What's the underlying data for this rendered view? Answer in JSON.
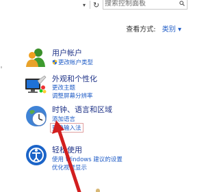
{
  "toolbar": {
    "dropdown_glyph": "▾",
    "refresh_glyph": "↻",
    "search_placeholder": "搜索控制面板"
  },
  "view_by": {
    "label": "查看方式:",
    "value": "类别 ▾"
  },
  "categories": [
    {
      "title": "用户帐户",
      "icon": "user-accounts-icon",
      "links": [
        {
          "label": "更改帐户类型",
          "shield": true
        }
      ]
    },
    {
      "title": "外观和个性化",
      "icon": "appearance-icon",
      "links": [
        {
          "label": "更改主题"
        },
        {
          "label": "调整屏幕分辨率"
        }
      ]
    },
    {
      "title": "时钟、语言和区域",
      "icon": "clock-language-region-icon",
      "links": [
        {
          "label": "添加语言"
        },
        {
          "label": "更换输入法"
        }
      ]
    },
    {
      "title": "轻松使用",
      "icon": "ease-of-access-icon",
      "links": [
        {
          "label": "使用 Windows 建议的设置"
        },
        {
          "label": "优化视觉显示"
        }
      ]
    }
  ],
  "annotation": {
    "arrow_color": "#d21f1f"
  }
}
